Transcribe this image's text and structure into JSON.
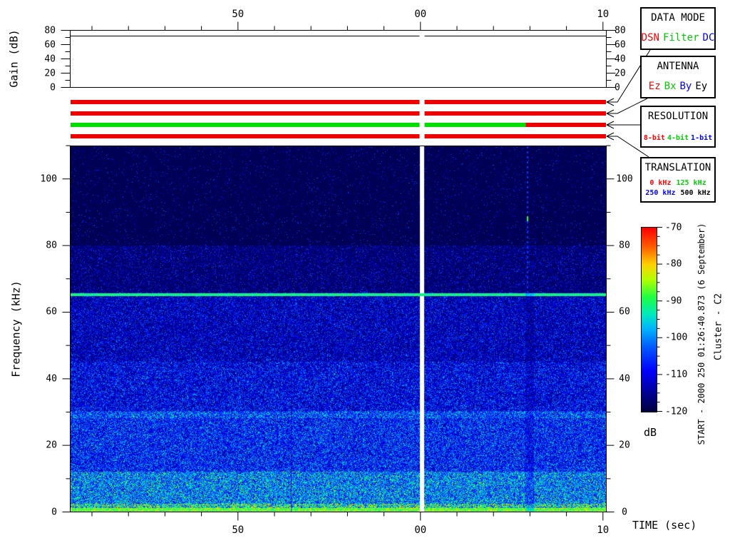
{
  "gain_panel": {
    "ylabel": "Gain (dB)",
    "ytick_labels": [
      "0",
      "20",
      "40",
      "60",
      "80"
    ]
  },
  "time_axis": {
    "xlabel": "TIME (sec)",
    "major_tick_labels": [
      "50",
      "00",
      "10"
    ]
  },
  "spectrogram_axis": {
    "ylabel": "Frequency (kHz)",
    "ytick_labels": [
      "0",
      "20",
      "40",
      "60",
      "80",
      "100"
    ]
  },
  "colorbar": {
    "unit_label": "dB",
    "tick_labels": [
      "-70",
      "-80",
      "-90",
      "-100",
      "-110",
      "-120"
    ]
  },
  "side_annotations": {
    "start_text": "START - 2000 250 01:26:40.873 (6 September)",
    "spacecraft_text": "Cluster - C2"
  },
  "info_boxes": {
    "data_mode": {
      "title": "DATA MODE",
      "items": [
        {
          "label": "DSN",
          "color": "#ff0000"
        },
        {
          "label": "Filter",
          "color": "#00cc00"
        },
        {
          "label": "DC",
          "color": "#0000ff"
        }
      ]
    },
    "antenna": {
      "title": "ANTENNA",
      "items": [
        {
          "label": "Ez",
          "color": "#ff0000"
        },
        {
          "label": "Bx",
          "color": "#00cc00"
        },
        {
          "label": "By",
          "color": "#0000ff"
        },
        {
          "label": "Ey",
          "color": "#000000"
        }
      ]
    },
    "resolution": {
      "title": "RESOLUTION",
      "items": [
        {
          "label": "8-bit",
          "color": "#ff0000"
        },
        {
          "label": "4-bit",
          "color": "#00cc00"
        },
        {
          "label": "1-bit",
          "color": "#0000ff"
        }
      ]
    },
    "translation": {
      "title": "TRANSLATION",
      "rows": [
        [
          {
            "label": "0 kHz",
            "color": "#ff0000"
          },
          {
            "label": "125 kHz",
            "color": "#00cc00"
          }
        ],
        [
          {
            "label": "250 kHz",
            "color": "#0000ff"
          },
          {
            "label": "500 kHz",
            "color": "#000000"
          }
        ]
      ]
    }
  },
  "status_bars": {
    "gap_frac": [
      0.6518,
      0.6611
    ],
    "bars": [
      {
        "name": "data-mode-bar",
        "segments": [
          {
            "f0": 0,
            "f1": 1,
            "color": "#ee0000"
          }
        ]
      },
      {
        "name": "antenna-bar",
        "segments": [
          {
            "f0": 0,
            "f1": 1,
            "color": "#ee0000"
          }
        ]
      },
      {
        "name": "resolution-bar",
        "segments": [
          {
            "f0": 0,
            "f1": 0.85,
            "color": "#00dd00"
          },
          {
            "f0": 0.85,
            "f1": 1,
            "color": "#ee0000"
          }
        ]
      },
      {
        "name": "translation-bar",
        "segments": [
          {
            "f0": 0,
            "f1": 1,
            "color": "#ee0000"
          }
        ]
      }
    ]
  },
  "chart_data": {
    "type": "heatmap",
    "title": "Cluster - C2 wideband spectrogram",
    "start_annotation": "START - 2000 250 01:26:40.873 (6 September)",
    "xlabel": "TIME (sec)",
    "ylabel": "Frequency (kHz)",
    "x_major_tick_labels": [
      "50",
      "00",
      "10"
    ],
    "x_minor_tick_interval_sec": 2,
    "ylim_khz": [
      0,
      110
    ],
    "y_tick_interval_khz": 20,
    "color_scale": {
      "unit": "dB",
      "min": -120,
      "max": -70,
      "tick_interval": 10,
      "style": "rainbow: red at -70 through yellow/green/cyan/blue to dark navy at -120",
      "legend_position": "right"
    },
    "gain_subplot": {
      "ylabel": "Gain (dB)",
      "ylim": [
        0,
        80
      ],
      "trace_db": 72,
      "trace_gap_at_label": "00"
    },
    "status_bars": [
      {
        "category": "DATA MODE",
        "value": "DSN",
        "color": "#ee0000"
      },
      {
        "category": "ANTENNA",
        "value": "Ez",
        "color": "#ee0000"
      },
      {
        "category": "RESOLUTION",
        "value": "4-bit switching to 8-bit at ~85% of interval",
        "segments": [
          {
            "from_frac": 0,
            "to_frac": 0.85,
            "color": "#00dd00"
          },
          {
            "from_frac": 0.85,
            "to_frac": 1,
            "color": "#ee0000"
          }
        ]
      },
      {
        "category": "TRANSLATION",
        "value": "0 kHz",
        "color": "#ee0000"
      }
    ],
    "features": [
      {
        "name": "narrowband emission line",
        "freq_khz": 65,
        "extent": "full width",
        "approx_level_db": -95
      },
      {
        "name": "data gap",
        "at_x_label": "00",
        "extent": "full height",
        "color": "white"
      },
      {
        "name": "broadband noise floor",
        "description": "near -120 dB above 80 kHz, rising toward low frequency; dense cyan below 12 kHz and bright green/yellow edge at 0-2 kHz"
      },
      {
        "name": "faint horizontal band",
        "freq_khz": 29
      },
      {
        "name": "faint dashed interference line",
        "x_frac": 0.85,
        "freq_range_khz": [
          66,
          110
        ]
      }
    ]
  }
}
